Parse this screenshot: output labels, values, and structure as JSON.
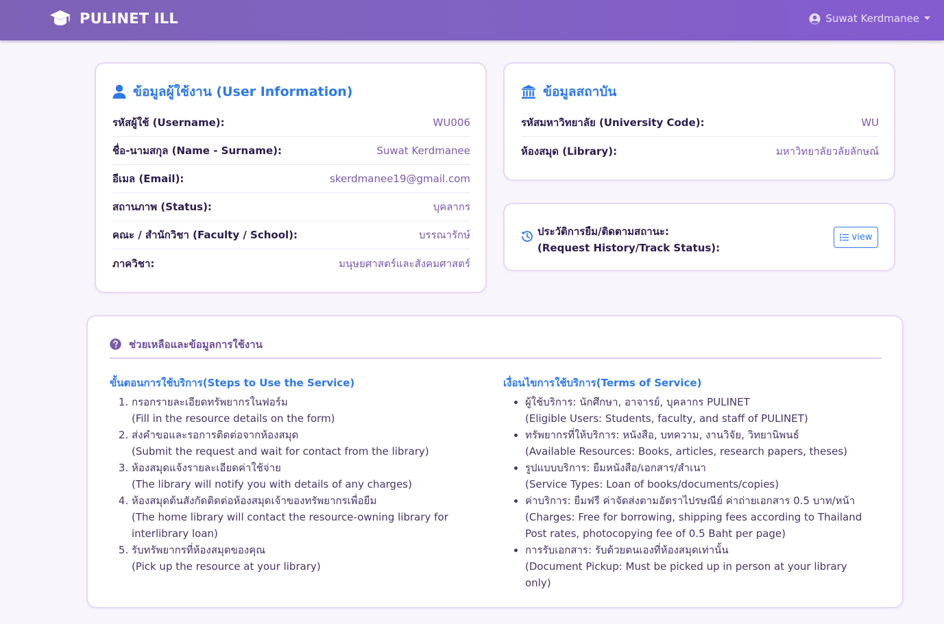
{
  "nav": {
    "brand": "PULINET ILL",
    "user_name": "Suwat Kerdmanee"
  },
  "user_info": {
    "title": "ข้อมูลผู้ใช้งาน (User Information)",
    "rows": [
      {
        "label": "รหัสผู้ใช้ (Username):",
        "value": "WU006"
      },
      {
        "label": "ชื่อ-นามสกุล (Name - Surname):",
        "value": "Suwat Kerdmanee"
      },
      {
        "label": "อีเมล (Email):",
        "value": "skerdmanee19@gmail.com"
      },
      {
        "label": "สถานภาพ (Status):",
        "value": "บุคลากร"
      },
      {
        "label": "คณะ / สำนักวิชา (Faculty / School):",
        "value": "บรรณารักษ์"
      },
      {
        "label": "ภาควิชา:",
        "value": "มนุษยศาสตร์และสังคมศาสตร์"
      }
    ]
  },
  "institution": {
    "title": "ข้อมูลสถาบัน",
    "rows": [
      {
        "label": "รหัสมหาวิทยาลัย (University Code):",
        "value": "WU"
      },
      {
        "label": "ห้องสมุด (Library):",
        "value": "มหาวิทยาลัยวลัยลักษณ์"
      }
    ]
  },
  "history": {
    "line1": "ประวัติการยืม/ติดตามสถานะ:",
    "line2": "(Request History/Track Status):",
    "button": "view"
  },
  "help": {
    "title": "ช่วยเหลือและข้อมูลการใช้งาน",
    "steps_title": "ขั้นตอนการใช้บริการ(Steps to Use the Service)",
    "steps": [
      {
        "th": "กรอกรายละเอียดทรัพยากรในฟอร์ม",
        "en": "(Fill in the resource details on the form)"
      },
      {
        "th": "ส่งคำขอและรอการติดต่อจากห้องสมุด",
        "en": "(Submit the request and wait for contact from the library)"
      },
      {
        "th": "ห้องสมุดแจ้งรายละเอียดค่าใช้จ่าย",
        "en": "(The library will notify you with details of any charges)"
      },
      {
        "th": "ห้องสมุดต้นสังกัดติดต่อห้องสมุดเจ้าของทรัพยากรเพื่อยืม",
        "en": "(The home library will contact the resource-owning library for interlibrary loan)"
      },
      {
        "th": "รับทรัพยากรที่ห้องสมุดของคุณ",
        "en": "(Pick up the resource at your library)"
      }
    ],
    "terms_title": "เงื่อนไขการใช้บริการ(Terms of Service)",
    "terms": [
      {
        "th": "ผู้ใช้บริการ: นักศึกษา, อาจารย์, บุคลากร PULINET",
        "en": "(Eligible Users: Students, faculty, and staff of PULINET)"
      },
      {
        "th": "ทรัพยากรที่ให้บริการ: หนังสือ, บทความ, งานวิจัย, วิทยานิพนธ์",
        "en": "(Available Resources: Books, articles, research papers, theses)"
      },
      {
        "th": "รูปแบบบริการ: ยืมหนังสือ/เอกสาร/สำเนา",
        "en": "(Service Types: Loan of books/documents/copies)"
      },
      {
        "th": "ค่าบริการ: ยืมฟรี ค่าจัดส่งตามอัตราไปรษณีย์ ค่าถ่ายเอกสาร 0.5 บาท/หน้า",
        "en": "(Charges: Free for borrowing, shipping fees according to Thailand Post rates, photocopying fee of 0.5 Baht per page)"
      },
      {
        "th": "การรับเอกสาร: รับด้วยตนเองที่ห้องสมุดเท่านั้น",
        "en": "(Document Pickup: Must be picked up in person at your library only)"
      }
    ]
  }
}
